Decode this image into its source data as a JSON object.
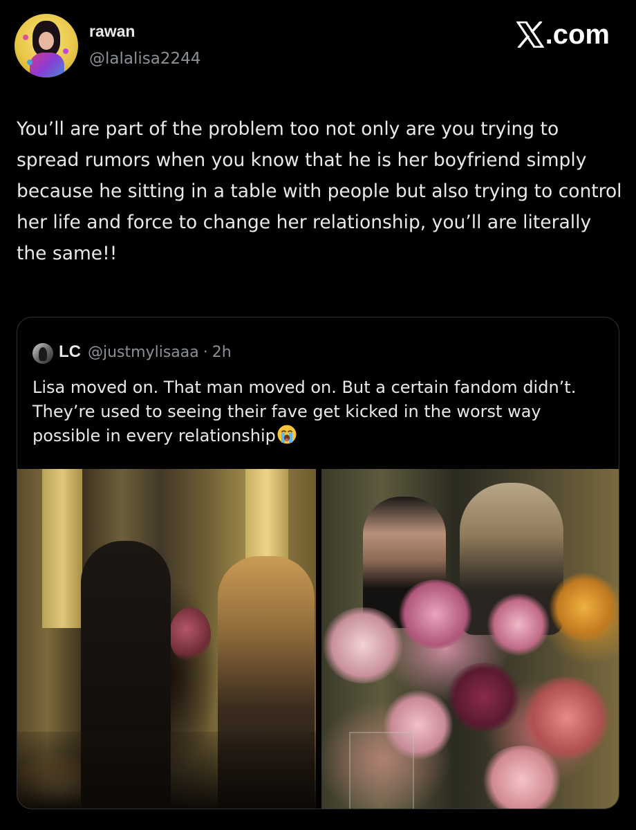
{
  "post": {
    "author": {
      "display_name": "rawan",
      "handle": "@lalalisa2244"
    },
    "brand": {
      "icon": "x-logo-icon",
      "text": ".com"
    },
    "text": "You’ll are part of the problem too not only are you trying to spread rumors when you know that he is her boyfriend simply because he sitting in a table with people but also trying to control her life and force to change her relationship, you’ll are literally the same!!"
  },
  "quote": {
    "author": {
      "display_name": "LC",
      "handle": "@justmylisaaa",
      "separator": "·",
      "time": "2h"
    },
    "text": "Lisa moved on. That man moved on. But a certain fandom didn’t. They’re used to seeing their fave get kicked in the worst way possible in every relationship",
    "emoji": "loudly-crying-face-icon",
    "media": [
      {
        "name": "photo-dinner-table-candlelight"
      },
      {
        "name": "photo-dinner-table-flowers"
      }
    ]
  },
  "colors": {
    "background": "#000000",
    "primary_text": "#e7e9ea",
    "secondary_text": "#8b9096",
    "card_border": "#2f3336"
  }
}
